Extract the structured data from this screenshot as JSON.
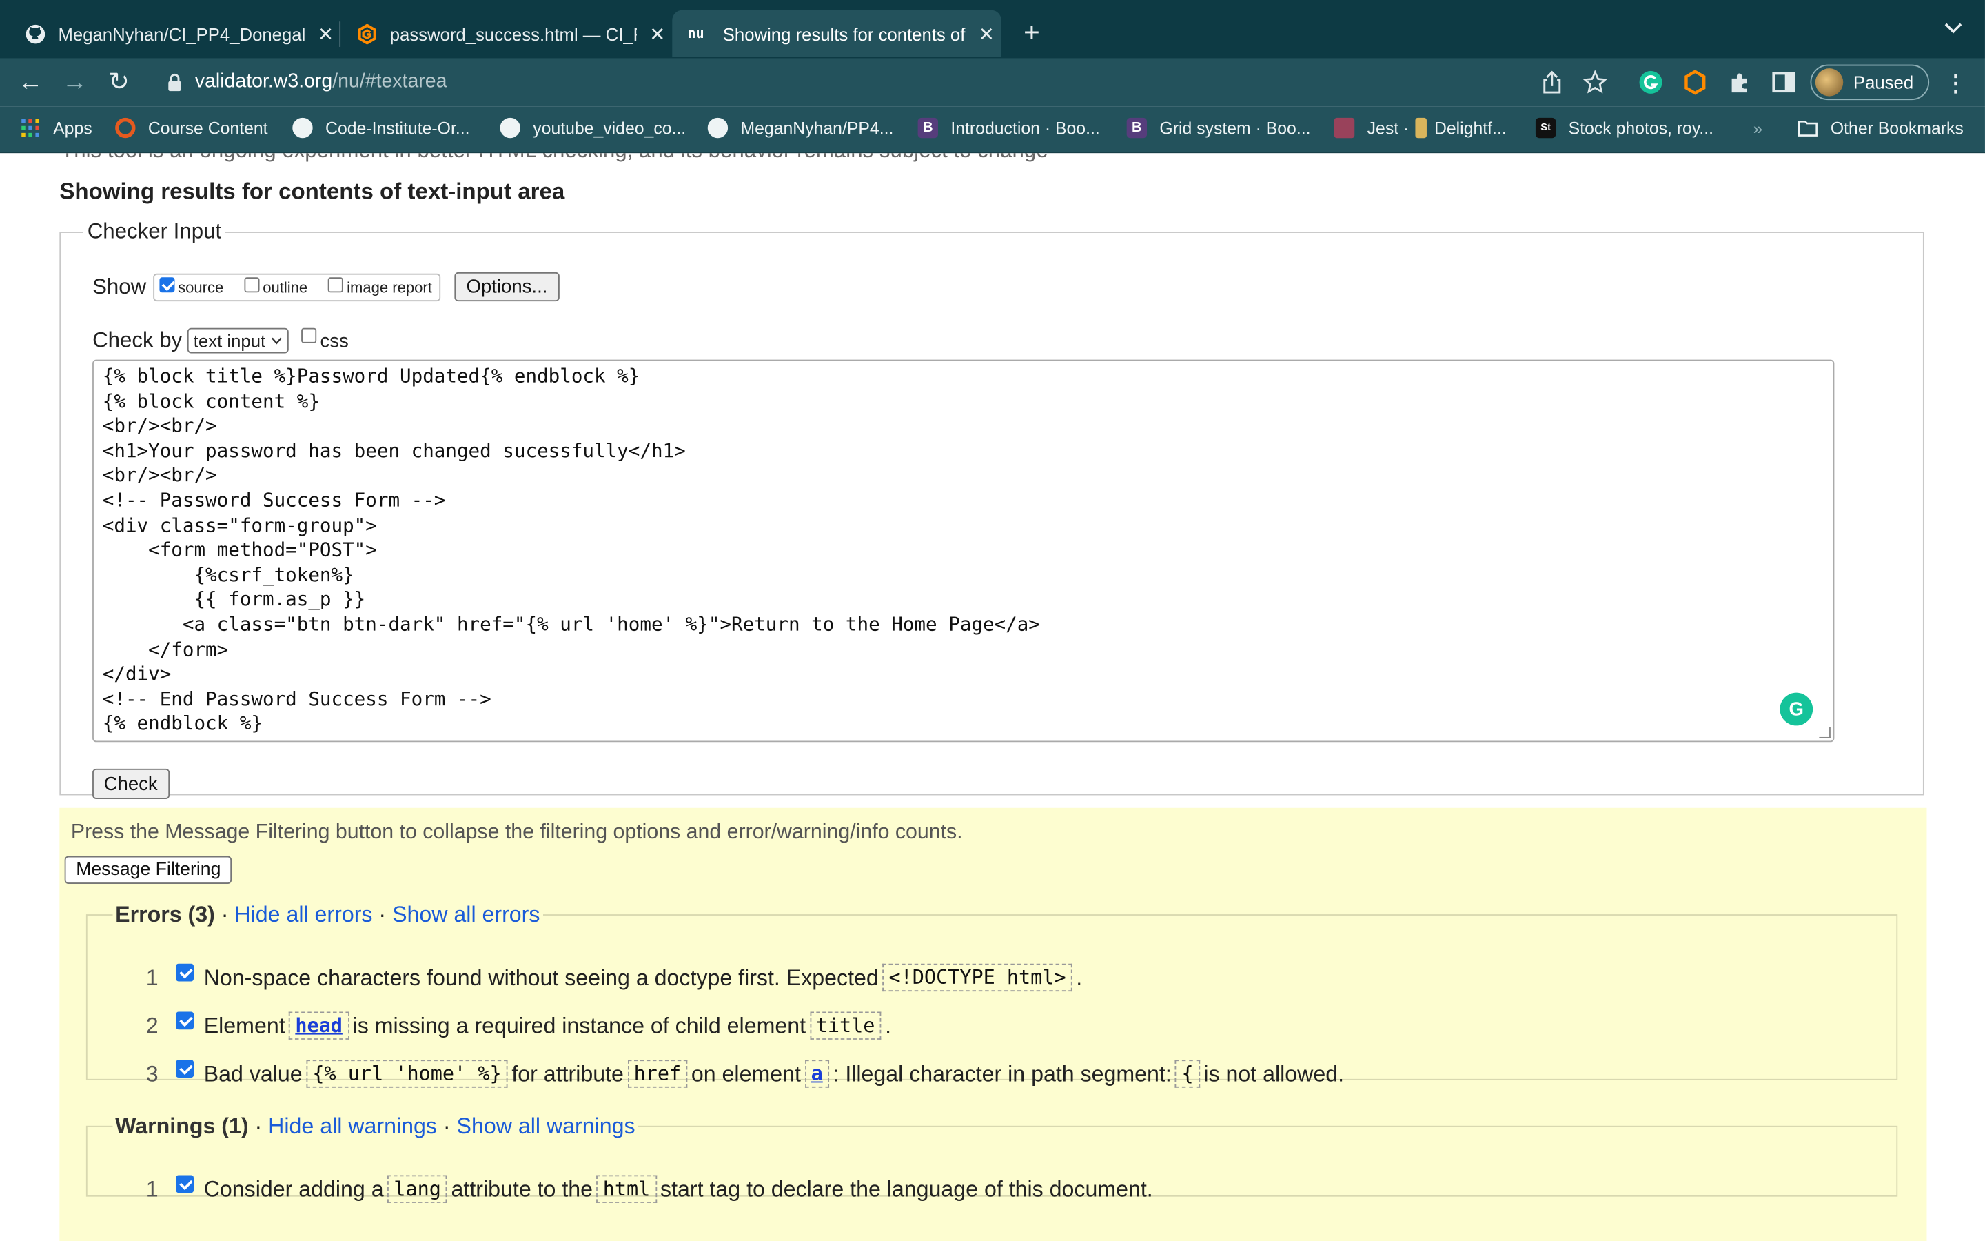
{
  "tabs": [
    {
      "title": "MeganNyhan/CI_PP4_Donegal_",
      "icon": "github-icon"
    },
    {
      "title": "password_success.html — CI_F",
      "icon": "gitpod-icon"
    },
    {
      "title": "Showing results for contents of",
      "icon": "nu-validator-icon"
    }
  ],
  "address": {
    "host": "validator.w3.org",
    "path": "/nu/#textarea"
  },
  "profile": {
    "label": "Paused"
  },
  "bookmarks": [
    {
      "label": "Apps"
    },
    {
      "label": "Course Content"
    },
    {
      "label": "Code-Institute-Or..."
    },
    {
      "label": "youtube_video_co..."
    },
    {
      "label": "MeganNyhan/PP4..."
    },
    {
      "label": "Introduction · Boo..."
    },
    {
      "label": "Grid system · Boo..."
    },
    {
      "label": "Jest ·"
    },
    {
      "label": "Delightf..."
    },
    {
      "label": "Stock photos, roy..."
    },
    {
      "label": "Other Bookmarks"
    }
  ],
  "page": {
    "cut_line": "This tool is an ongoing experiment in better HTML checking, and its behavior remains subject to change",
    "heading": "Showing results for contents of text-input area",
    "checker": {
      "legend": "Checker Input",
      "show_label": "Show",
      "options": [
        {
          "label": "source",
          "checked": true
        },
        {
          "label": "outline",
          "checked": false
        },
        {
          "label": "image report",
          "checked": false
        }
      ],
      "options_button": "Options...",
      "check_by_label": "Check by",
      "check_by_value": "text input",
      "css_label": "css",
      "source": "{% block title %}Password Updated{% endblock %}\n{% block content %}\n<br/><br/>\n<h1>Your password has been changed sucessfully</h1>\n<br/><br/>\n<!-- Password Success Form -->\n<div class=\"form-group\">\n    <form method=\"POST\">\n        {%csrf_token%}\n        {{ form.as_p }}\n       <a class=\"btn btn-dark\" href=\"{% url 'home' %}\">Return to the Home Page</a>\n    </form>\n</div>\n<!-- End Password Success Form -->\n{% endblock %}",
      "check_button": "Check"
    },
    "results": {
      "press_text": "Press the Message Filtering button to collapse the filtering options and error/warning/info counts.",
      "filter_button": "Message Filtering",
      "errors": {
        "title": "Errors (3)",
        "hide": "Hide all errors",
        "show": "Show all errors",
        "items": [
          {
            "num": "1",
            "parts": [
              "Non-space characters found without seeing a doctype first. Expected ",
              "<!DOCTYPE html>",
              "."
            ]
          },
          {
            "num": "2",
            "parts": [
              "Element ",
              "head",
              " is missing a required instance of child element ",
              "title",
              "."
            ]
          },
          {
            "num": "3",
            "parts": [
              "Bad value ",
              "{% url 'home' %}",
              " for attribute ",
              "href",
              " on element ",
              "a",
              ": Illegal character in path segment: ",
              "{",
              " is not allowed."
            ]
          }
        ]
      },
      "warnings": {
        "title": "Warnings (1)",
        "hide": "Hide all warnings",
        "show": "Show all warnings",
        "items": [
          {
            "num": "1",
            "parts": [
              "Consider adding a ",
              "lang",
              " attribute to the ",
              "html",
              " start tag to declare the language of this document."
            ]
          }
        ]
      }
    }
  }
}
